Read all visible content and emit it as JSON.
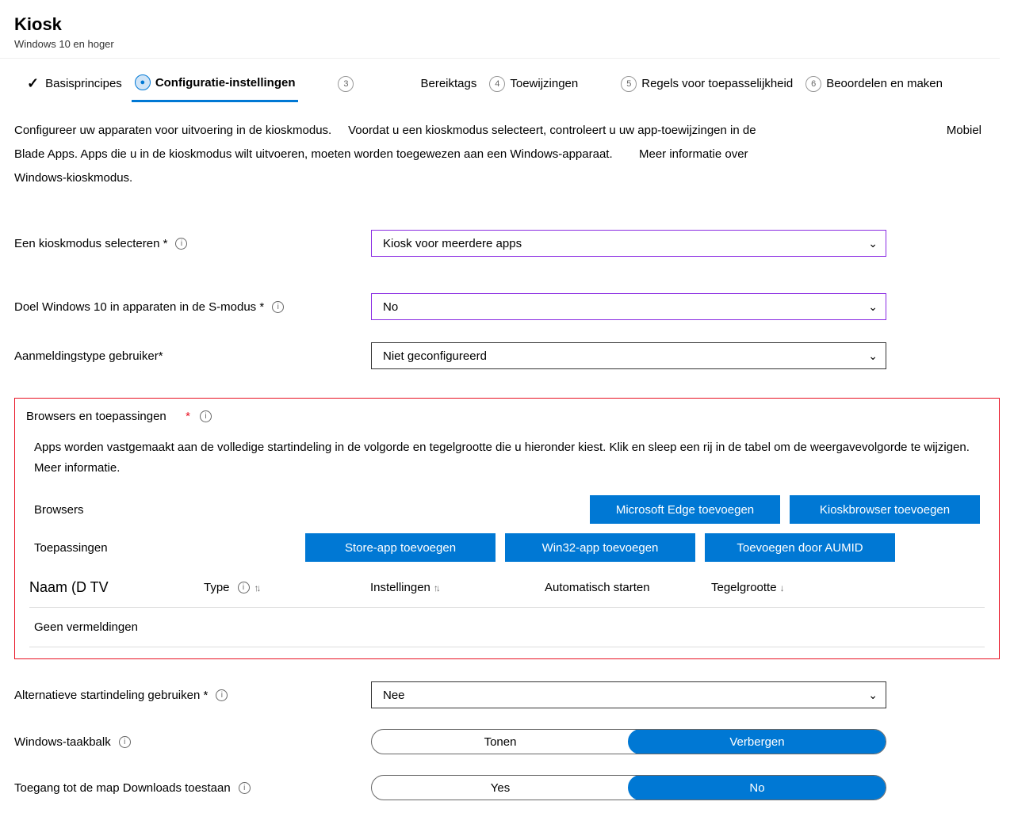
{
  "header": {
    "title": "Kiosk",
    "subtitle": "Windows 10 en hoger"
  },
  "tabs": {
    "t1": "Basisprincipes",
    "t2": "Configuratie-instellingen",
    "t3": "Bereiktags",
    "t4": "Toewijzingen",
    "t5": "Regels voor toepasselijkheid",
    "t6": "Beoordelen en maken",
    "n3": "3",
    "n4": "4",
    "n5": "5",
    "n6": "6"
  },
  "intro": {
    "line1a": "Configureer uw apparaten voor uitvoering in de kioskmodus.",
    "line1b": "Voordat u een kioskmodus selecteert, controleert u uw app-toewijzingen in de",
    "mobiel": "Mobiel",
    "line2a": "Blade Apps. Apps die u in de kioskmodus wilt uitvoeren, moeten worden toegewezen aan een Windows-apparaat.",
    "line2b": "Meer informatie over",
    "line3": "Windows-kioskmodus."
  },
  "fields": {
    "kioskMode": {
      "label": "Een kioskmodus selecteren *",
      "value": "Kiosk voor meerdere apps"
    },
    "smode": {
      "label": "Doel Windows 10 in apparaten in de S-modus *",
      "value": "No"
    },
    "logonType": {
      "label": "Aanmeldingstype gebruiker*",
      "value": "Niet geconfigureerd"
    },
    "altStart": {
      "label": "Alternatieve startindeling gebruiken *",
      "value": "Nee"
    }
  },
  "browsersSection": {
    "title": "Browsers en toepassingen",
    "desc": "Apps worden vastgemaakt aan de volledige startindeling in de volgorde en tegelgrootte die u hieronder kiest. Klik en sleep een rij in de tabel om de weergavevolgorde te wijzigen. Meer informatie.",
    "browsersLabel": "Browsers",
    "appsLabel": "Toepassingen",
    "btnEdge": "Microsoft Edge toevoegen",
    "btnKiosk": "Kioskbrowser toevoegen",
    "btnStore": "Store-app toevoegen",
    "btnWin32": "Win32-app toevoegen",
    "btnAumid": "Toevoegen door AUMID",
    "cols": {
      "c1": "Naam (D TV",
      "c2": "Type",
      "c3": "Instellingen",
      "c4": "Automatisch starten",
      "c5": "Tegelgrootte"
    },
    "empty": "Geen vermeldingen"
  },
  "toggles": {
    "taskbar": {
      "label": "Windows-taakbalk",
      "opt1": "Tonen",
      "opt2": "Verbergen"
    },
    "downloads": {
      "label": "Toegang tot de map Downloads toestaan",
      "opt1": "Yes",
      "opt2": "No"
    }
  }
}
